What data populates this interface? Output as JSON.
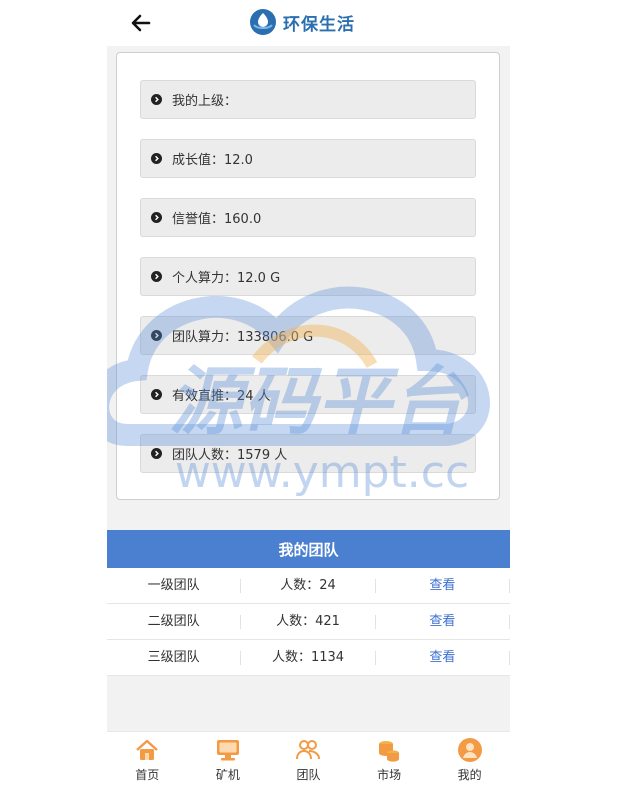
{
  "header": {
    "title": "环保生活"
  },
  "info_items": [
    {
      "label": "我的上级："
    },
    {
      "label": "成长值：12.0"
    },
    {
      "label": "信誉值：160.0"
    },
    {
      "label": "个人算力：12.0 G"
    },
    {
      "label": "团队算力：133806.0 G"
    },
    {
      "label": "有效直推：24 人"
    },
    {
      "label": "团队人数：1579 人"
    }
  ],
  "watermark": {
    "line1": "源码平台",
    "line2": "www.ympt.cc"
  },
  "team": {
    "title": "我的团队",
    "rows": [
      {
        "level": "一级团队",
        "count": "人数：24",
        "action": "查看"
      },
      {
        "level": "二级团队",
        "count": "人数：421",
        "action": "查看"
      },
      {
        "level": "三级团队",
        "count": "人数：1134",
        "action": "查看"
      }
    ]
  },
  "tabbar": [
    {
      "label": "首页",
      "icon": "home-icon"
    },
    {
      "label": "矿机",
      "icon": "monitor-icon"
    },
    {
      "label": "团队",
      "icon": "team-icon"
    },
    {
      "label": "市场",
      "icon": "coins-icon"
    },
    {
      "label": "我的",
      "icon": "user-icon"
    }
  ],
  "colors": {
    "accent": "#4a80cf",
    "link": "#3f6fd1",
    "brand": "#2a6fb0",
    "tab_icon": "#f39a45"
  }
}
